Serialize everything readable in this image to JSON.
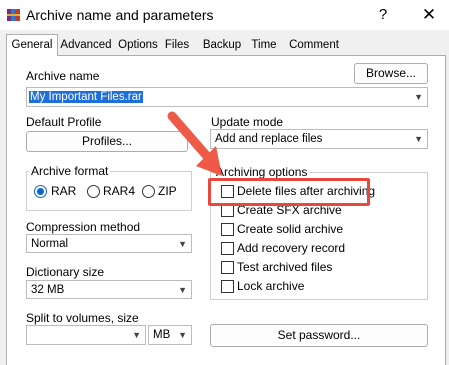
{
  "window": {
    "title": "Archive name and parameters",
    "help_glyph": "?",
    "close_glyph": "✕"
  },
  "tabs": [
    {
      "label": "General",
      "active": true
    },
    {
      "label": "Advanced",
      "active": false
    },
    {
      "label": "Options",
      "active": false
    },
    {
      "label": "Files",
      "active": false
    },
    {
      "label": "Backup",
      "active": false
    },
    {
      "label": "Time",
      "active": false
    },
    {
      "label": "Comment",
      "active": false
    }
  ],
  "archive_name": {
    "label": "Archive name",
    "value": "My Important Files.rar",
    "browse_label": "Browse..."
  },
  "default_profile": {
    "label": "Default Profile",
    "button_label": "Profiles..."
  },
  "update_mode": {
    "label": "Update mode",
    "value": "Add and replace files"
  },
  "archive_format": {
    "label": "Archive format",
    "options": [
      "RAR",
      "RAR4",
      "ZIP"
    ],
    "selected": "RAR"
  },
  "compression_method": {
    "label": "Compression method",
    "value": "Normal"
  },
  "dictionary_size": {
    "label": "Dictionary size",
    "value": "32 MB"
  },
  "split_volumes": {
    "label": "Split to volumes, size",
    "value": "",
    "unit": "MB"
  },
  "archiving_options": {
    "label": "Archiving options",
    "items": [
      {
        "label": "Delete files after archiving",
        "checked": false,
        "highlighted": true
      },
      {
        "label": "Create SFX archive",
        "checked": false
      },
      {
        "label": "Create solid archive",
        "checked": false
      },
      {
        "label": "Add recovery record",
        "checked": false
      },
      {
        "label": "Test archived files",
        "checked": false
      },
      {
        "label": "Lock archive",
        "checked": false
      }
    ]
  },
  "set_password_label": "Set password...",
  "colors": {
    "accent": "#0a64d6",
    "highlight_box": "#e8473d",
    "arrow": "#ef5a48"
  },
  "icons": {
    "app": "winrar-books-icon",
    "pointer": "red-arrow-annotation"
  }
}
